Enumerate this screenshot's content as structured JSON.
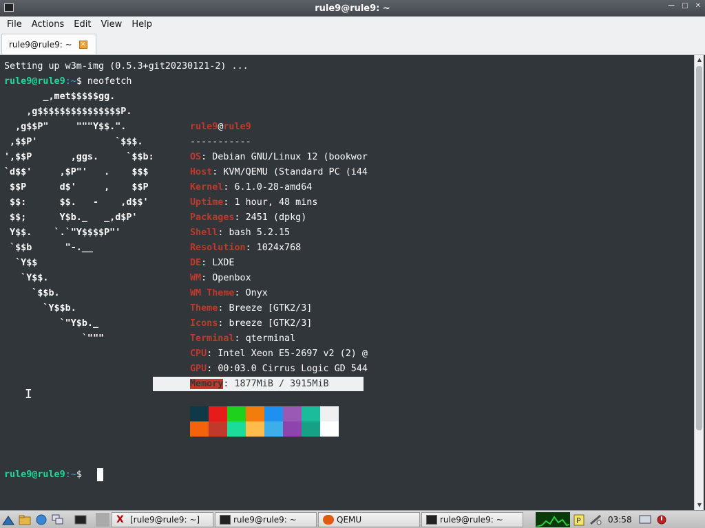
{
  "window": {
    "title": "rule9@rule9: ~",
    "controls": [
      "—",
      "□",
      "✕"
    ]
  },
  "menubar": {
    "items": [
      "File",
      "Actions",
      "Edit",
      "View",
      "Help"
    ]
  },
  "tabs": [
    {
      "label": "rule9@rule9: ~",
      "close": "✕"
    }
  ],
  "terminal": {
    "setup_line": "Setting up w3m-img (0.5.3+git20230121-2) ...",
    "prompt_user": "rule9@rule9",
    "prompt_path": ":~",
    "prompt_symbol": "$",
    "command": " neofetch",
    "logo": [
      "       _,met$$$$$gg.",
      "    ,g$$$$$$$$$$$$$$$P.",
      "  ,g$$P\"     \"\"\"Y$$.\".",
      " ,$$P'              `$$$.",
      "',$$P       ,ggs.     `$$b:",
      "`d$$'     ,$P\"'   .    $$$",
      " $$P      d$'     ,    $$P",
      " $$:      $$.   -    ,d$$'",
      " $$;      Y$b._   _,d$P'",
      " Y$$.    `.`\"Y$$$$P\"'",
      " `$$b      \"-.__",
      "  `Y$$",
      "   `Y$$.",
      "     `$$b.",
      "       `Y$$b.",
      "          `\"Y$b._",
      "              `\"\"\""
    ],
    "info_user": "rule9",
    "info_at": "@",
    "info_host": "rule9",
    "separator": "-----------",
    "info": [
      {
        "label": "OS",
        "value": "Debian GNU/Linux 12 (bookwor"
      },
      {
        "label": "Host",
        "value": "KVM/QEMU (Standard PC (i44"
      },
      {
        "label": "Kernel",
        "value": "6.1.0-28-amd64"
      },
      {
        "label": "Uptime",
        "value": "1 hour, 48 mins"
      },
      {
        "label": "Packages",
        "value": "2451 (dpkg)"
      },
      {
        "label": "Shell",
        "value": "bash 5.2.15"
      },
      {
        "label": "Resolution",
        "value": "1024x768"
      },
      {
        "label": "DE",
        "value": "LXDE"
      },
      {
        "label": "WM",
        "value": "Openbox"
      },
      {
        "label": "WM Theme",
        "value": "Onyx"
      },
      {
        "label": "Theme",
        "value": "Breeze [GTK2/3]"
      },
      {
        "label": "Icons",
        "value": "breeze [GTK2/3]"
      },
      {
        "label": "Terminal",
        "value": "qterminal"
      },
      {
        "label": "CPU",
        "value": "Intel Xeon E5-2697 v2 (2) @"
      },
      {
        "label": "GPU",
        "value": "00:03.0 Cirrus Logic GD 544"
      },
      {
        "label": "Memory",
        "value": "1877MiB / 3915MiB"
      }
    ],
    "colors_row1": [
      "#0e3947",
      "#e81b1b",
      "#1dd11d",
      "#f27d0c",
      "#1e91f0",
      "#9b59b6",
      "#1abc9c",
      "#eff0f1"
    ],
    "colors_row2": [
      "#f5620c",
      "#c0392b",
      "#1cdc9a",
      "#fdbc4b",
      "#3daee9",
      "#8e44ad",
      "#16a085",
      "#ffffff"
    ]
  },
  "taskbar": {
    "tasks": [
      {
        "label": "[rule9@rule9: ~]",
        "icon": "xterm-icon"
      },
      {
        "label": "rule9@rule9: ~",
        "icon": "terminal-icon"
      },
      {
        "label": "QEMU",
        "icon": "qemu-icon"
      },
      {
        "label": "rule9@rule9: ~",
        "icon": "terminal-icon"
      }
    ],
    "clock": "03:58"
  }
}
